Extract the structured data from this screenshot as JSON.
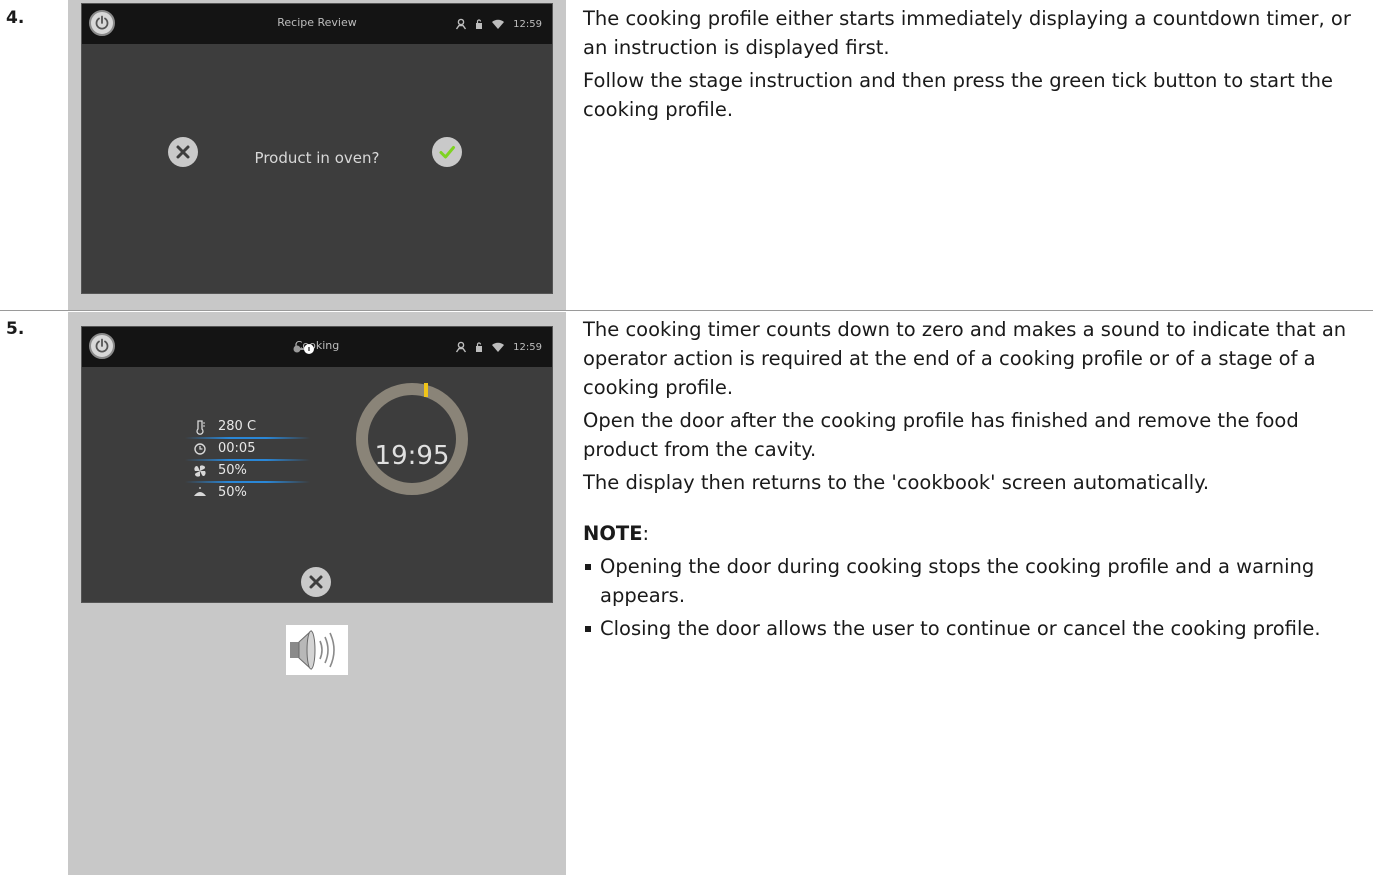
{
  "steps": [
    {
      "number": "4.",
      "screen": {
        "title": "Recipe Review",
        "time": "12:59",
        "prompt": "Product in oven?"
      },
      "paragraphs": [
        "The cooking profile either starts immediately displaying a countdown timer, or an instruction is displayed first.",
        "Follow the stage instruction and then press the green tick button to start the cooking profile."
      ]
    },
    {
      "number": "5.",
      "screen": {
        "title": "Cooking",
        "time": "12:59",
        "params": [
          {
            "icon": "thermometer-icon",
            "value": "280 C"
          },
          {
            "icon": "clock-icon",
            "value": "00:05"
          },
          {
            "icon": "fan-icon",
            "value": "50%"
          },
          {
            "icon": "steam-icon",
            "value": "50%"
          }
        ],
        "timer": "19:95"
      },
      "paragraphs": [
        "The cooking timer counts down to zero and makes a sound to indicate that an operator action is required at the end of a cooking profile or of a stage of a cooking profile.",
        "Open the door after the cooking profile has finished and remove the food product from the cavity.",
        "The display then returns to the 'cookbook' screen automatically."
      ],
      "note": {
        "label": "NOTE",
        "colon": ":",
        "items": [
          "Opening the door during cooking stops the cooking profile and a warning appears.",
          "Closing the door allows the user to continue or cancel the cooking profile."
        ]
      }
    }
  ],
  "colors": {
    "screen_bg": "#3d3d3d",
    "topbar_bg": "#141414",
    "tick_green": "#7ed321",
    "accent_blue": "#2a87d7",
    "timer_ring": "#8a8478",
    "timer_marker": "#f0c419",
    "panel_bg": "#c8c8c8"
  }
}
